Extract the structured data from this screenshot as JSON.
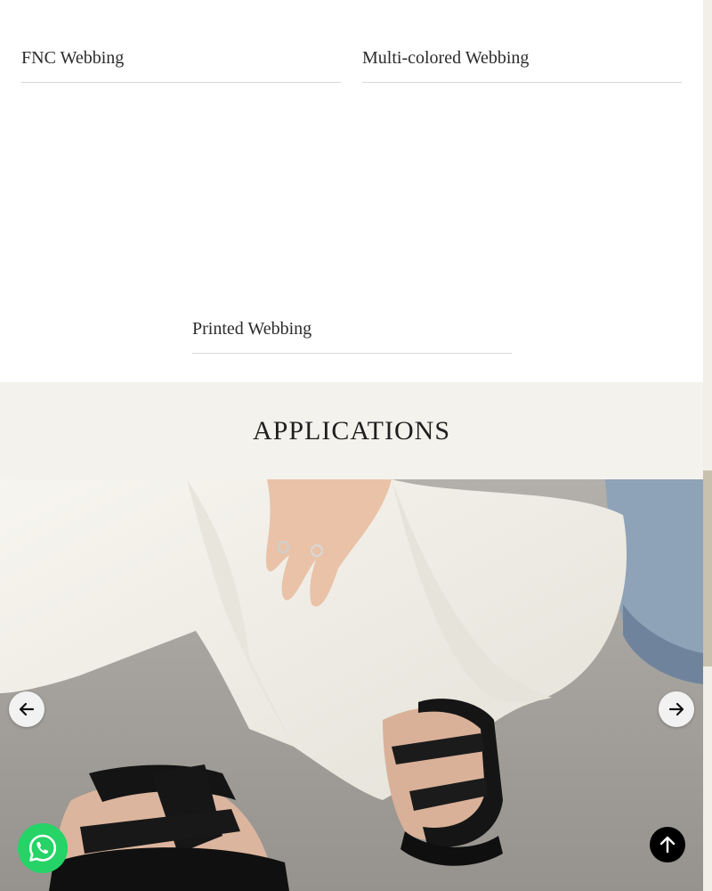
{
  "products": {
    "items": [
      {
        "label": "FNC Webbing"
      },
      {
        "label": "Multi-colored Webbing"
      },
      {
        "label": "Printed Webbing"
      }
    ]
  },
  "applications": {
    "title": "APPLICATIONS"
  },
  "slider": {
    "image": "woman-wearing-black-strap-sandals-photo",
    "prev_icon": "arrow-left-icon",
    "next_icon": "arrow-right-icon"
  },
  "floating": {
    "chat_icon": "whatsapp-icon",
    "top_icon": "arrow-up-icon"
  },
  "colors": {
    "section_bg": "#f3f2ec",
    "whatsapp": "#25d366",
    "to_top": "#000000"
  }
}
